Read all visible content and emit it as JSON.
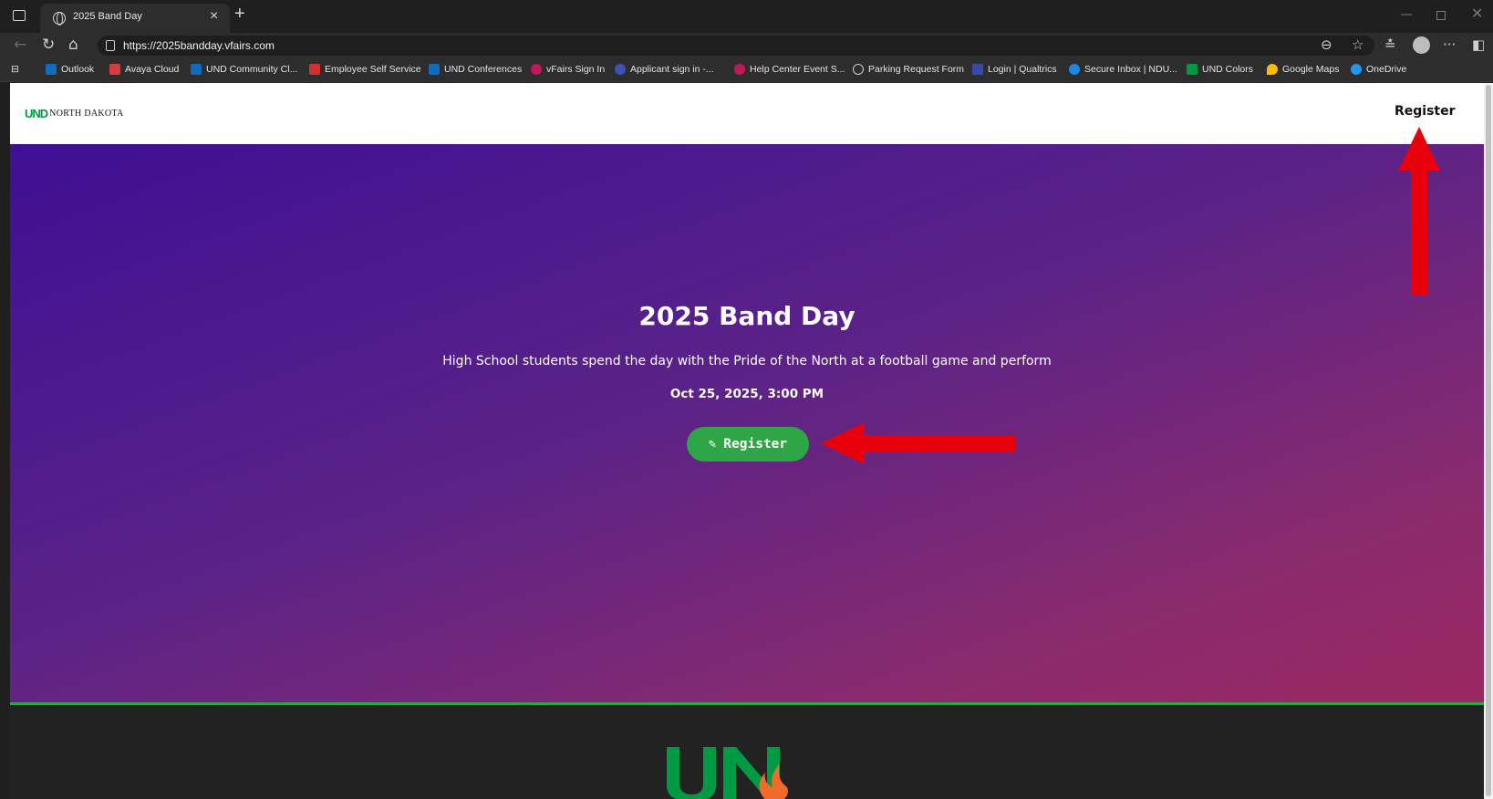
{
  "browser": {
    "tab_title": "2025 Band Day",
    "url": "https://2025bandday.vfairs.com",
    "bookmarks": [
      {
        "label": "Outlook",
        "color": "#0f6cbd"
      },
      {
        "label": "Avaya Cloud",
        "color": "#d83b3b"
      },
      {
        "label": "UND Community Cl...",
        "color": "#0f6cbd"
      },
      {
        "label": "Employee Self Service",
        "color": "#d32f2f"
      },
      {
        "label": "UND Conferences",
        "color": "#0f6cbd"
      },
      {
        "label": "vFairs Sign In",
        "color": "#c2185b"
      },
      {
        "label": "Applicant sign in -...",
        "color": "#3f51b5"
      },
      {
        "label": "Help Center Event S...",
        "color": "#c2185b"
      },
      {
        "label": "Parking Request Form",
        "color": "#cfcfcf"
      },
      {
        "label": "Login | Qualtrics",
        "color": "#3949ab"
      },
      {
        "label": "Secure Inbox | NDU...",
        "color": "#1e88e5"
      },
      {
        "label": "UND Colors",
        "color": "#009a44"
      },
      {
        "label": "Google Maps",
        "color": "#fbbc05"
      },
      {
        "label": "OneDrive",
        "color": "#2196f3"
      }
    ]
  },
  "site": {
    "logo_mark": "UND",
    "logo_text": "NORTH DAKOTA",
    "nav_register": "Register",
    "hero": {
      "title": "2025 Band Day",
      "subtitle": "High School students spend the day with the Pride of the North at a football game and perform",
      "date": "Oct 25, 2025, 3:00 PM",
      "button_label": "Register"
    }
  },
  "colors": {
    "accent_green": "#2ea546",
    "arrow_red": "#e8000b"
  }
}
